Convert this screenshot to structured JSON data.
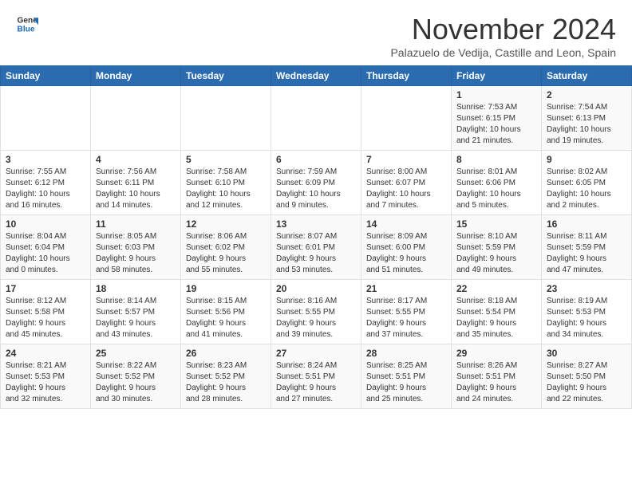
{
  "header": {
    "logo_general": "General",
    "logo_blue": "Blue",
    "month_title": "November 2024",
    "location": "Palazuelo de Vedija, Castille and Leon, Spain"
  },
  "calendar": {
    "days_of_week": [
      "Sunday",
      "Monday",
      "Tuesday",
      "Wednesday",
      "Thursday",
      "Friday",
      "Saturday"
    ],
    "weeks": [
      [
        {
          "day": "",
          "info": ""
        },
        {
          "day": "",
          "info": ""
        },
        {
          "day": "",
          "info": ""
        },
        {
          "day": "",
          "info": ""
        },
        {
          "day": "",
          "info": ""
        },
        {
          "day": "1",
          "info": "Sunrise: 7:53 AM\nSunset: 6:15 PM\nDaylight: 10 hours\nand 21 minutes."
        },
        {
          "day": "2",
          "info": "Sunrise: 7:54 AM\nSunset: 6:13 PM\nDaylight: 10 hours\nand 19 minutes."
        }
      ],
      [
        {
          "day": "3",
          "info": "Sunrise: 7:55 AM\nSunset: 6:12 PM\nDaylight: 10 hours\nand 16 minutes."
        },
        {
          "day": "4",
          "info": "Sunrise: 7:56 AM\nSunset: 6:11 PM\nDaylight: 10 hours\nand 14 minutes."
        },
        {
          "day": "5",
          "info": "Sunrise: 7:58 AM\nSunset: 6:10 PM\nDaylight: 10 hours\nand 12 minutes."
        },
        {
          "day": "6",
          "info": "Sunrise: 7:59 AM\nSunset: 6:09 PM\nDaylight: 10 hours\nand 9 minutes."
        },
        {
          "day": "7",
          "info": "Sunrise: 8:00 AM\nSunset: 6:07 PM\nDaylight: 10 hours\nand 7 minutes."
        },
        {
          "day": "8",
          "info": "Sunrise: 8:01 AM\nSunset: 6:06 PM\nDaylight: 10 hours\nand 5 minutes."
        },
        {
          "day": "9",
          "info": "Sunrise: 8:02 AM\nSunset: 6:05 PM\nDaylight: 10 hours\nand 2 minutes."
        }
      ],
      [
        {
          "day": "10",
          "info": "Sunrise: 8:04 AM\nSunset: 6:04 PM\nDaylight: 10 hours\nand 0 minutes."
        },
        {
          "day": "11",
          "info": "Sunrise: 8:05 AM\nSunset: 6:03 PM\nDaylight: 9 hours\nand 58 minutes."
        },
        {
          "day": "12",
          "info": "Sunrise: 8:06 AM\nSunset: 6:02 PM\nDaylight: 9 hours\nand 55 minutes."
        },
        {
          "day": "13",
          "info": "Sunrise: 8:07 AM\nSunset: 6:01 PM\nDaylight: 9 hours\nand 53 minutes."
        },
        {
          "day": "14",
          "info": "Sunrise: 8:09 AM\nSunset: 6:00 PM\nDaylight: 9 hours\nand 51 minutes."
        },
        {
          "day": "15",
          "info": "Sunrise: 8:10 AM\nSunset: 5:59 PM\nDaylight: 9 hours\nand 49 minutes."
        },
        {
          "day": "16",
          "info": "Sunrise: 8:11 AM\nSunset: 5:59 PM\nDaylight: 9 hours\nand 47 minutes."
        }
      ],
      [
        {
          "day": "17",
          "info": "Sunrise: 8:12 AM\nSunset: 5:58 PM\nDaylight: 9 hours\nand 45 minutes."
        },
        {
          "day": "18",
          "info": "Sunrise: 8:14 AM\nSunset: 5:57 PM\nDaylight: 9 hours\nand 43 minutes."
        },
        {
          "day": "19",
          "info": "Sunrise: 8:15 AM\nSunset: 5:56 PM\nDaylight: 9 hours\nand 41 minutes."
        },
        {
          "day": "20",
          "info": "Sunrise: 8:16 AM\nSunset: 5:55 PM\nDaylight: 9 hours\nand 39 minutes."
        },
        {
          "day": "21",
          "info": "Sunrise: 8:17 AM\nSunset: 5:55 PM\nDaylight: 9 hours\nand 37 minutes."
        },
        {
          "day": "22",
          "info": "Sunrise: 8:18 AM\nSunset: 5:54 PM\nDaylight: 9 hours\nand 35 minutes."
        },
        {
          "day": "23",
          "info": "Sunrise: 8:19 AM\nSunset: 5:53 PM\nDaylight: 9 hours\nand 34 minutes."
        }
      ],
      [
        {
          "day": "24",
          "info": "Sunrise: 8:21 AM\nSunset: 5:53 PM\nDaylight: 9 hours\nand 32 minutes."
        },
        {
          "day": "25",
          "info": "Sunrise: 8:22 AM\nSunset: 5:52 PM\nDaylight: 9 hours\nand 30 minutes."
        },
        {
          "day": "26",
          "info": "Sunrise: 8:23 AM\nSunset: 5:52 PM\nDaylight: 9 hours\nand 28 minutes."
        },
        {
          "day": "27",
          "info": "Sunrise: 8:24 AM\nSunset: 5:51 PM\nDaylight: 9 hours\nand 27 minutes."
        },
        {
          "day": "28",
          "info": "Sunrise: 8:25 AM\nSunset: 5:51 PM\nDaylight: 9 hours\nand 25 minutes."
        },
        {
          "day": "29",
          "info": "Sunrise: 8:26 AM\nSunset: 5:51 PM\nDaylight: 9 hours\nand 24 minutes."
        },
        {
          "day": "30",
          "info": "Sunrise: 8:27 AM\nSunset: 5:50 PM\nDaylight: 9 hours\nand 22 minutes."
        }
      ]
    ]
  }
}
